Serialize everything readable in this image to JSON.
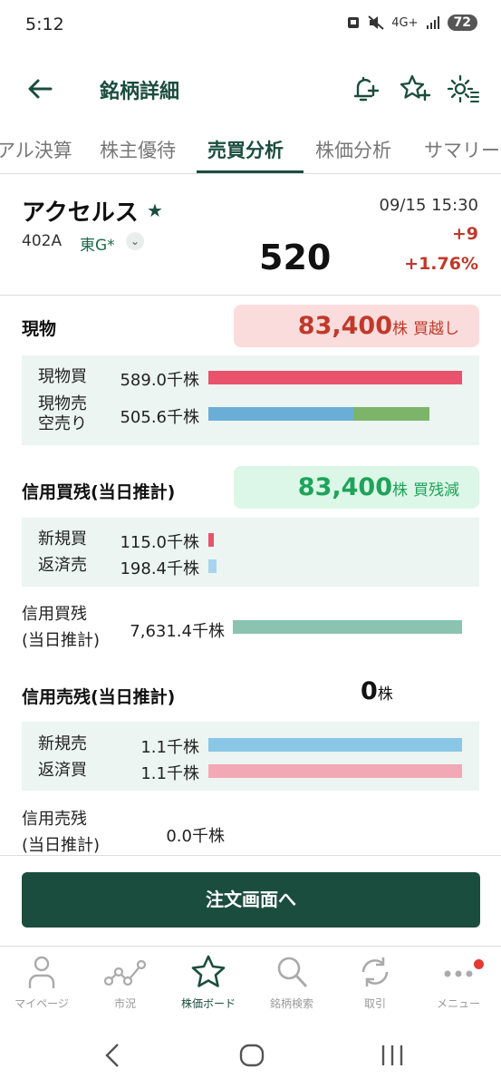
{
  "status_bar": {
    "time": "5:12",
    "network": "4G+",
    "battery": "72"
  },
  "header": {
    "title": "銘柄詳細"
  },
  "tabs": [
    {
      "label": "アル決算"
    },
    {
      "label": "株主優待"
    },
    {
      "label": "売買分析",
      "active": true
    },
    {
      "label": "株価分析"
    },
    {
      "label": "サマリー"
    }
  ],
  "stock": {
    "name": "アクセルス",
    "code": "402A",
    "market": "東G*",
    "price": "520",
    "datetime": "09/15 15:30",
    "change": "+9",
    "change_pct": "+1.76%"
  },
  "spot": {
    "title": "現物",
    "summary_value": "83,400",
    "summary_unit": "株",
    "summary_label": "買越し",
    "rows": [
      {
        "label": "現物買",
        "value": "589.0千株",
        "bar_fraction": 1.0
      },
      {
        "label_line1": "現物売",
        "label_line2": "空売り",
        "value": "505.6千株",
        "bar_fraction_spot_sell": 0.57,
        "bar_fraction_short": 0.3
      }
    ]
  },
  "margin_buy": {
    "title": "信用買残(当日推計)",
    "summary_value": "83,400",
    "summary_unit": "株",
    "summary_label": "買残減",
    "rows": [
      {
        "label": "新規買",
        "value": "115.0千株"
      },
      {
        "label": "返済売",
        "value": "198.4千株"
      }
    ],
    "balance_label_line1": "信用買残",
    "balance_label_line2": "(当日推計)",
    "balance_value": "7,631.4千株"
  },
  "margin_sell": {
    "title": "信用売残(当日推計)",
    "summary_value": "0",
    "summary_unit": "株",
    "rows": [
      {
        "label": "新規売",
        "value": "1.1千株",
        "bar_fraction": 1.0
      },
      {
        "label": "返済買",
        "value": "1.1千株",
        "bar_fraction": 1.0
      }
    ],
    "balance_label_line1": "信用売残",
    "balance_label_line2": "(当日推計)",
    "balance_value": "0.0千株"
  },
  "order_button": "注文画面へ",
  "bottom_nav": [
    {
      "label": "マイページ",
      "icon": "person-icon"
    },
    {
      "label": "市況",
      "icon": "market-chart-icon"
    },
    {
      "label": "株価ボード",
      "icon": "star-icon",
      "active": true
    },
    {
      "label": "銘柄検索",
      "icon": "search-icon"
    },
    {
      "label": "取引",
      "icon": "trade-cycle-icon"
    },
    {
      "label": "メニュー",
      "icon": "more-dots-icon",
      "badge": true
    }
  ],
  "colors": {
    "brand": "#1b4d3e",
    "up_red": "#c0392b",
    "buy_bar": "#e8536b",
    "sell_bar": "#6aaed8",
    "short_bar": "#7cb46a",
    "balance_bar": "#8ac4b0",
    "panel_bg": "#ecf5f1"
  }
}
